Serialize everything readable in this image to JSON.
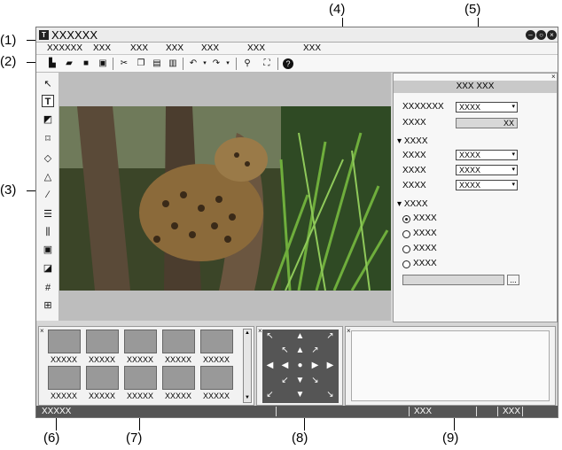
{
  "callouts": [
    "(1)",
    "(2)",
    "(3)",
    "(4)",
    "(5)",
    "(6)",
    "(7)",
    "(8)",
    "(9)"
  ],
  "window": {
    "title": "XXXXXX",
    "app_icon": "T",
    "buttons": [
      "minimize-icon",
      "restore-icon",
      "close-icon"
    ]
  },
  "menu": [
    "XXXXXX",
    "XXX",
    "XXX",
    "XXX",
    "XXX",
    "XXX",
    "XXX"
  ],
  "toolbar_icons": [
    "new-icon",
    "open-icon",
    "save-icon",
    "save-as-icon",
    "cut-icon",
    "copy-icon",
    "paste-icon",
    "delete-icon",
    "undo-icon",
    "dropdown-icon",
    "redo-icon",
    "dropdown-icon",
    "find-icon",
    "fit-icon",
    "help-icon"
  ],
  "tool_icons": [
    "select-icon",
    "text-icon",
    "image-icon",
    "rectangle-icon",
    "ellipse-icon",
    "polygon-icon",
    "line-icon",
    "align-icon",
    "distribute-icon",
    "arrange-icon",
    "layer-icon",
    "grid-icon",
    "safe-area-icon"
  ],
  "properties": {
    "header": "XXX XXX",
    "row1": {
      "label": "XXXXXXX",
      "value": "XXXX"
    },
    "row2": {
      "label": "XXXX",
      "value": "XX"
    },
    "section1": "XXXX",
    "sub_rows": [
      {
        "label": "XXXX",
        "value": "XXXX"
      },
      {
        "label": "XXXX",
        "value": "XXXX"
      },
      {
        "label": "XXXX",
        "value": "XXXX"
      }
    ],
    "section2": "XXXX",
    "radios": [
      "XXXX",
      "XXXX",
      "XXXX",
      "XXXX"
    ],
    "browse_label": "..."
  },
  "thumbnails": {
    "labels": [
      "XXXXX",
      "XXXXX",
      "XXXXX",
      "XXXXX",
      "XXXXX",
      "XXXXX",
      "XXXXX",
      "XXXXX",
      "XXXXX",
      "XXXXX"
    ]
  },
  "status": {
    "left": "XXXXX",
    "mid": "XXX",
    "right": "XXX"
  }
}
